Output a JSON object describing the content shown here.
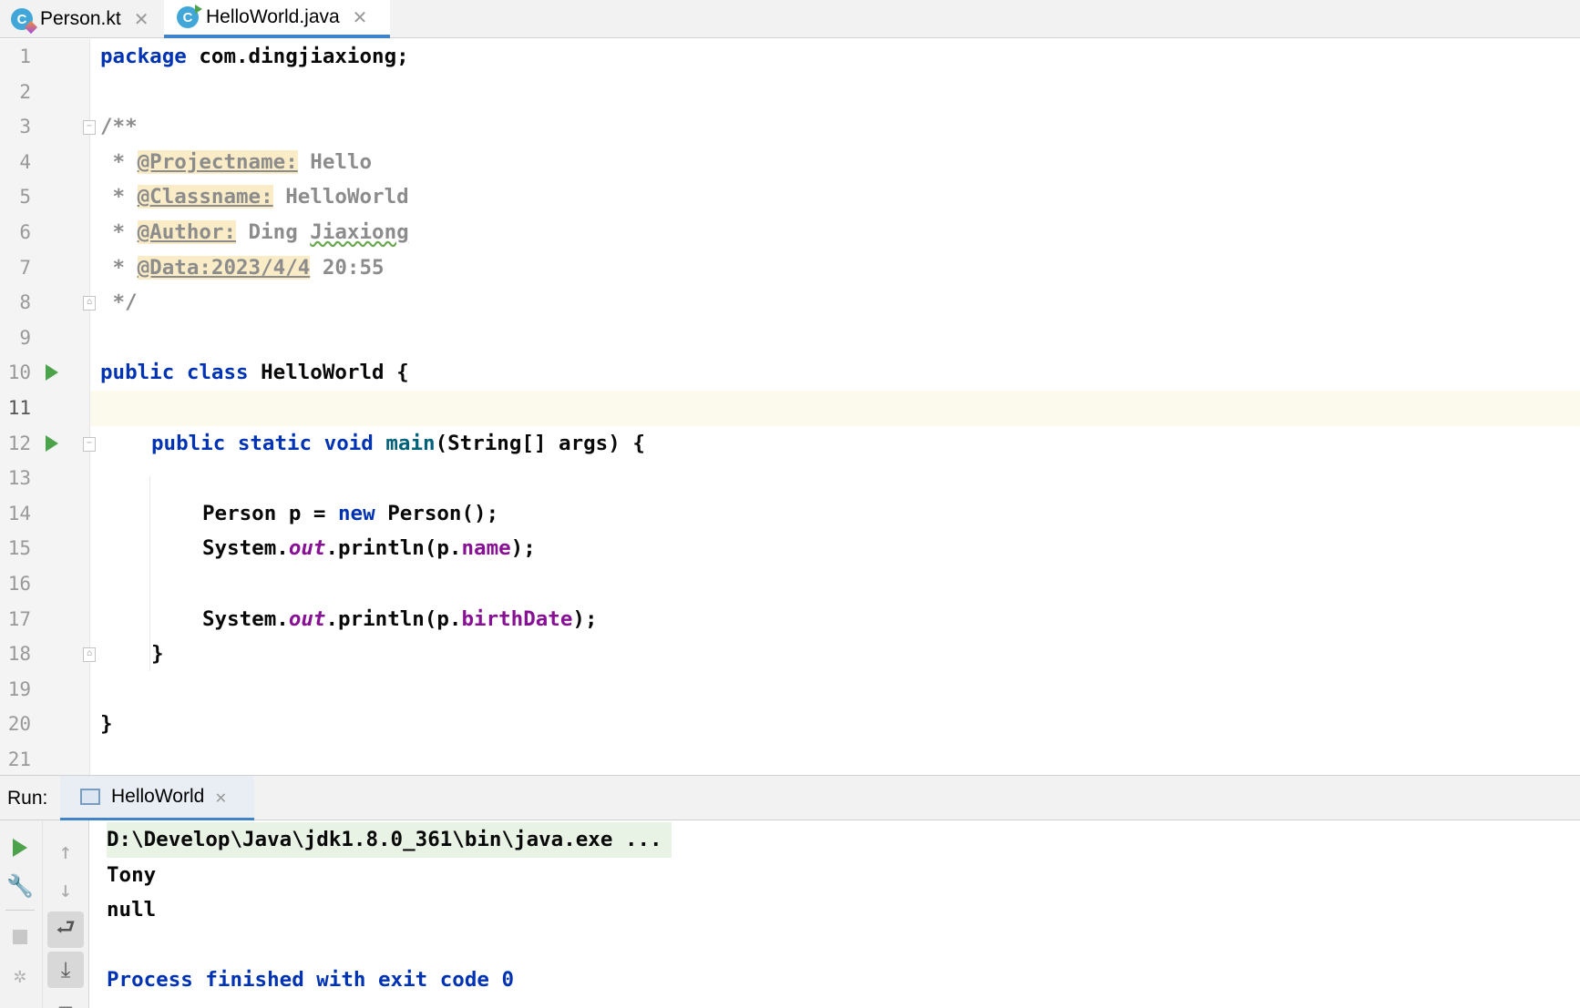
{
  "tabs": [
    {
      "label": "Person.kt",
      "icon": "kotlin-class-icon",
      "active": false
    },
    {
      "label": "HelloWorld.java",
      "icon": "java-class-icon",
      "active": true
    }
  ],
  "editor": {
    "line_numbers": [
      "1",
      "2",
      "3",
      "4",
      "5",
      "6",
      "7",
      "8",
      "9",
      "10",
      "11",
      "12",
      "13",
      "14",
      "15",
      "16",
      "17",
      "18",
      "19",
      "20",
      "21"
    ],
    "current_line": "11",
    "lines": {
      "l1_kw": "package",
      "l1_rest": " com.dingjiaxiong;",
      "l3": "/**",
      "l4_star": " * ",
      "l4_tag": "@Projectname:",
      "l4_val": " Hello",
      "l5_star": " * ",
      "l5_tag": "@Classname:",
      "l5_val": " HelloWorld",
      "l6_star": " * ",
      "l6_tag": "@Author:",
      "l6_val1": " Ding ",
      "l6_val2": "Jiaxiong",
      "l7_star": " * ",
      "l7_tag": "@Data:2023/4/4",
      "l7_val": " 20:55",
      "l8": " */",
      "l10_kw": "public class",
      "l10_rest": " HelloWorld {",
      "l12_kw": "public static void",
      "l12_fn": "main",
      "l12_rest": "(String[] args) {",
      "l14_a": "Person p = ",
      "l14_kw": "new",
      "l14_b": " Person();",
      "l15_a": "System.",
      "l15_out": "out",
      "l15_b": ".println(p.",
      "l15_fld": "name",
      "l15_c": ");",
      "l17_a": "System.",
      "l17_out": "out",
      "l17_b": ".println(p.",
      "l17_fld": "birthDate",
      "l17_c": ");",
      "l18": "}",
      "l20": "}"
    }
  },
  "run": {
    "label": "Run:",
    "tab_label": "HelloWorld",
    "output": {
      "cmd": "D:\\Develop\\Java\\jdk1.8.0_361\\bin\\java.exe ...",
      "line1": "Tony",
      "line2": "null",
      "finish": "Process finished with exit code 0"
    }
  },
  "colors": {
    "keyword": "#0033b3",
    "field": "#871094",
    "method": "#00627a",
    "comment": "#8c8c8c",
    "run_green": "#4ca34c",
    "accent": "#4083c9"
  }
}
